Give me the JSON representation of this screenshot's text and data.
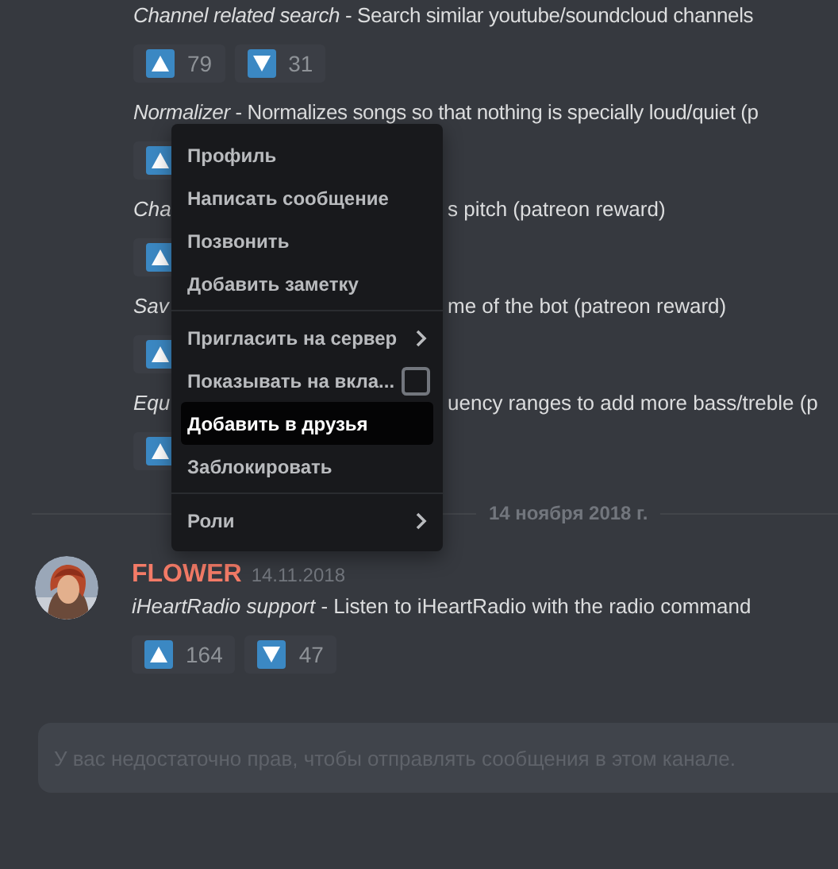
{
  "messages": [
    {
      "feature": "Channel related search",
      "description": " - Search similar youtube/soundcloud channels",
      "reactions": [
        {
          "kind": "up",
          "count": "79"
        },
        {
          "kind": "down",
          "count": "31"
        }
      ]
    },
    {
      "feature": "Normalizer",
      "description": " - Normalizes songs so that nothing is specially loud/quiet (p",
      "reactions": [
        {
          "kind": "up"
        }
      ]
    },
    {
      "feature": "Cha",
      "tail": "s pitch (patreon reward)",
      "reactions": [
        {
          "kind": "up"
        }
      ]
    },
    {
      "feature": "Sav",
      "tail": "me of the bot (patreon reward)",
      "reactions": [
        {
          "kind": "up"
        }
      ]
    },
    {
      "feature": "Equ",
      "tail": "uency ranges to add more bass/treble (p",
      "reactions": [
        {
          "kind": "up"
        }
      ]
    }
  ],
  "date_divider": "14 ноября 2018 г.",
  "post": {
    "author": "FLOWER",
    "color": "#f47b67",
    "timestamp": "14.11.2018",
    "feature": "iHeartRadio support",
    "description": " - Listen to iHeartRadio with the radio command",
    "reactions": [
      {
        "kind": "up",
        "count": "164"
      },
      {
        "kind": "down",
        "count": "47"
      }
    ]
  },
  "context_menu": [
    {
      "kind": "item",
      "label": "Профиль",
      "highlighted": false
    },
    {
      "kind": "item",
      "label": "Написать сообщение",
      "highlighted": false
    },
    {
      "kind": "item",
      "label": "Позвонить",
      "highlighted": false
    },
    {
      "kind": "item",
      "label": "Добавить заметку",
      "highlighted": false
    },
    {
      "kind": "separator"
    },
    {
      "kind": "submenu",
      "label": "Пригласить на сервер",
      "highlighted": false
    },
    {
      "kind": "checkbox",
      "label": "Показывать на вкла...",
      "checked": false,
      "highlighted": false
    },
    {
      "kind": "item",
      "label": "Добавить в друзья",
      "highlighted": true
    },
    {
      "kind": "item",
      "label": "Заблокировать",
      "highlighted": false
    },
    {
      "kind": "separator"
    },
    {
      "kind": "submenu",
      "label": "Роли",
      "highlighted": false
    }
  ],
  "composer": {
    "placeholder": "У вас недостаточно прав, чтобы отправлять сообщения в этом канале."
  }
}
